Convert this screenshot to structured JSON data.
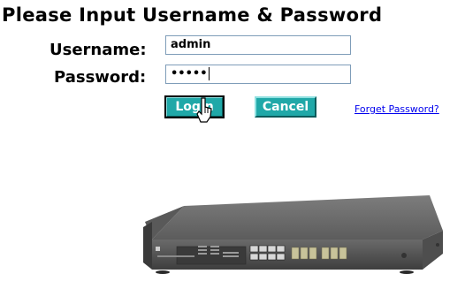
{
  "title": "Please Input Username & Password",
  "username": {
    "label": "Username:",
    "value": "admin"
  },
  "password": {
    "label": "Password:",
    "value": "•••••"
  },
  "buttons": {
    "login": "Login",
    "cancel": "Cancel"
  },
  "forget_link": "Forget Password?",
  "icons": {
    "cursor": "pointer-cursor-icon",
    "device": "network-switch-image"
  }
}
